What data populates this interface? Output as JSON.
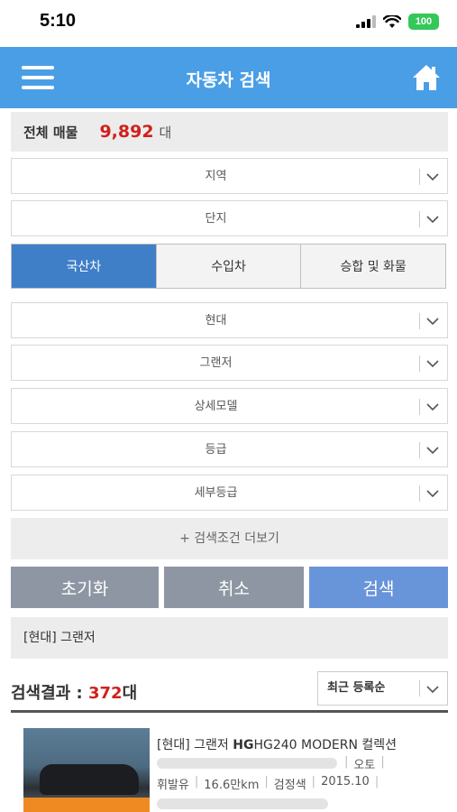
{
  "status": {
    "time": "5:10",
    "battery": "100"
  },
  "appbar": {
    "title": "자동차 검색"
  },
  "total": {
    "label": "전체 매물",
    "count": "9,892",
    "unit": "대"
  },
  "filters": {
    "region": "지역",
    "complex": "단지",
    "maker": "현대",
    "model": "그랜저",
    "detail_model": "상세모델",
    "grade": "등급",
    "detail_grade": "세부등급"
  },
  "origin_tabs": [
    "국산차",
    "수입차",
    "승합 및 화물"
  ],
  "more_conditions": "+ 검색조건 더보기",
  "buttons": {
    "reset": "초기화",
    "cancel": "취소",
    "search": "검색"
  },
  "selected_summary": "[현대] 그랜저",
  "results": {
    "label": "검색결과 : ",
    "count": "372",
    "unit": "대",
    "sort": "최근 등록순"
  },
  "listing": {
    "title_prefix": "[현대] 그랜저 ",
    "title_model": "HG",
    "title_rest": "HG240 MODERN 컬렉션",
    "transmission": "오토",
    "fuel": "휘발유",
    "mileage": "16.6만km",
    "color": "검정색",
    "year": "2015.10"
  },
  "colors": {
    "header": "#4a9ee6",
    "accent_red": "#d0211c",
    "active_tab": "#3f7fc8",
    "search_button": "#6894d9",
    "gray_button": "#8e96a3"
  }
}
